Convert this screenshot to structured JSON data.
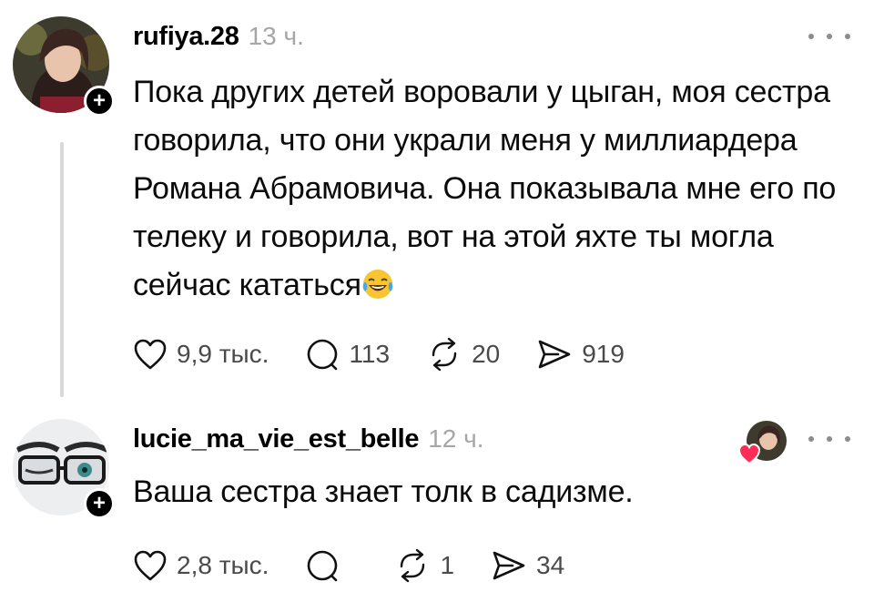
{
  "posts": [
    {
      "username": "rufiya.28",
      "time": "13 ч.",
      "text": "Пока других детей воровали у цыган, моя сестра говорила, что они украли меня у миллиардера Романа Абрамовича. Она показывала мне его по телеку и говорила, вот на этой яхте ты могла сейчас кататься",
      "emoji": "face-with-tears-of-joy",
      "likes": "9,9 тыс.",
      "comments": "113",
      "reposts": "20",
      "shares": "919",
      "follow_label": "+"
    },
    {
      "username": "lucie_ma_vie_est_belle",
      "time": "12 ч.",
      "text": "Ваша сестра знает толк в садизме.",
      "likes": "2,8 тыс.",
      "comments": "",
      "reposts": "1",
      "shares": "34",
      "follow_label": "+"
    }
  ],
  "icons": {
    "like": "heart-icon",
    "comment": "comment-icon",
    "repost": "repost-icon",
    "share": "send-icon",
    "more": "more-icon"
  },
  "colors": {
    "text": "#0b0b0b",
    "muted": "#a6a6a6",
    "thread_line": "#d9d9d9"
  }
}
